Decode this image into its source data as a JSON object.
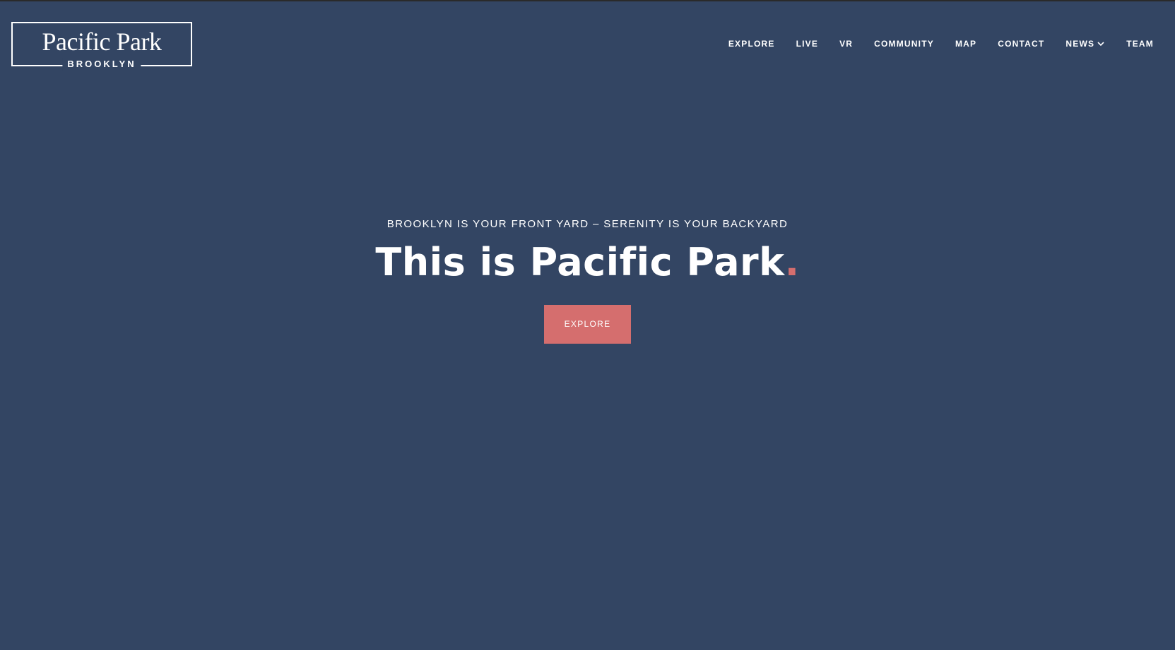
{
  "brand": {
    "name": "Pacific Park",
    "location": "BROOKLYN"
  },
  "nav": {
    "items": [
      "EXPLORE",
      "LIVE",
      "VR",
      "COMMUNITY",
      "MAP",
      "CONTACT",
      "NEWS",
      "TEAM"
    ]
  },
  "hero": {
    "tagline": "BROOKLYN IS YOUR FRONT YARD – SERENITY IS YOUR BACKYARD",
    "headline": "This is Pacific Park",
    "headline_dot": ".",
    "cta_label": "EXPLORE"
  },
  "colors": {
    "background": "#334563",
    "accent": "#d56e6e",
    "text": "#ffffff"
  },
  "icons": {
    "news_dropdown": "chevron-down-icon"
  }
}
